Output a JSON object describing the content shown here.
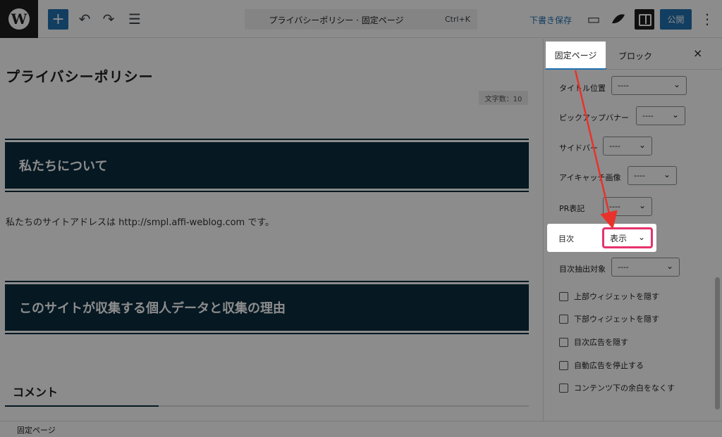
{
  "toolbar": {
    "wp_logo": "W",
    "add_icon": "+",
    "undo_icon": "↶",
    "redo_icon": "↷",
    "list_view_icon": "☰",
    "doc_title": "プライバシーポリシー · 固定ページ",
    "shortcut": "Ctrl+K",
    "save_draft": "下書き保存",
    "view_icon": "▭",
    "publish": "公開",
    "more_icon": "⋮",
    "accent": "#2271b1"
  },
  "editor": {
    "title": "プライバシーポリシー",
    "char_count": "文字数：10",
    "heading1": "私たちについて",
    "paragraph": "私たちのサイトアドレスは http://smpl.affi-weblog.com です。",
    "heading2": "このサイトが収集する個人データと収集の理由",
    "comment_heading": "コメント",
    "heading_color": "#0c2c3e"
  },
  "breadcrumb": "固定ページ",
  "sidebar": {
    "tabs": [
      "固定ページ",
      "ブロック"
    ],
    "close_icon": "×",
    "fields": [
      {
        "label": "タイトル位置",
        "value": "----"
      },
      {
        "label": "ピックアップバナー",
        "value": "----"
      },
      {
        "label": "サイドバー",
        "value": "----"
      },
      {
        "label": "アイキャッチ画像",
        "value": "----"
      },
      {
        "label": "PR表記",
        "value": "----"
      },
      {
        "label": "目次",
        "value": "表示"
      },
      {
        "label": "目次抽出対象",
        "value": "----"
      }
    ],
    "checkboxes": [
      "上部ウィジェットを隠す",
      "下部ウィジェットを隠す",
      "目次広告を隠す",
      "自動広告を停止する",
      "コンテンツ下の余白をなくす"
    ],
    "highlight_color": "#e6336b",
    "arrow_color": "#e8322b"
  }
}
